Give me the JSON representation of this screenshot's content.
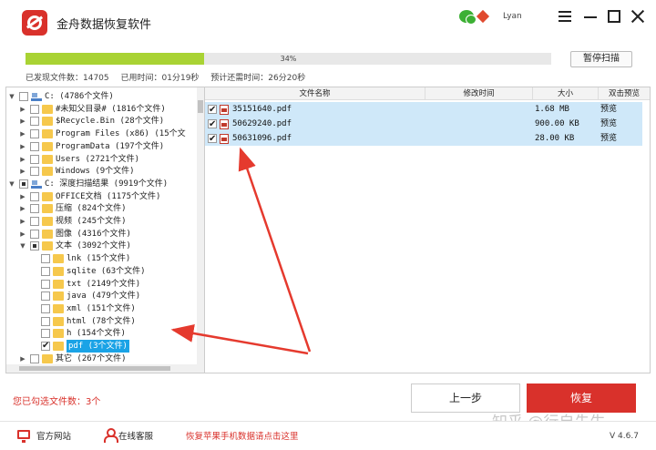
{
  "app": {
    "title": "金舟数据恢复软件",
    "user": "Lyan"
  },
  "scan": {
    "progress_label": "34%",
    "progress_fraction": 0.34,
    "pause_label": "暂停扫描",
    "found": "已发现文件数：14705",
    "elapsed": "已用时间：01分19秒",
    "remaining": "预计还需时间：26分20秒"
  },
  "tree": [
    {
      "label": "C:   (4786个文件)",
      "level": 0,
      "expander": "▼",
      "icon": "drive-icon",
      "check": ""
    },
    {
      "label": "#未知父目录#   (1816个文件)",
      "level": 1,
      "expander": "▶",
      "icon": "folder-icon",
      "check": ""
    },
    {
      "label": "$Recycle.Bin   (28个文件)",
      "level": 1,
      "expander": "▶",
      "icon": "folder-icon",
      "check": ""
    },
    {
      "label": "Program Files (x86)   (15个文",
      "level": 1,
      "expander": "▶",
      "icon": "folder-icon",
      "check": ""
    },
    {
      "label": "ProgramData   (197个文件)",
      "level": 1,
      "expander": "▶",
      "icon": "folder-icon",
      "check": ""
    },
    {
      "label": "Users   (2721个文件)",
      "level": 1,
      "expander": "▶",
      "icon": "folder-icon",
      "check": ""
    },
    {
      "label": "Windows   (9个文件)",
      "level": 1,
      "expander": "▶",
      "icon": "folder-icon",
      "check": ""
    },
    {
      "label": "C: 深度扫描结果   (9919个文件)",
      "level": 0,
      "expander": "▼",
      "icon": "drive-icon",
      "check": "partial"
    },
    {
      "label": "OFFICE文档   (1175个文件)",
      "level": 1,
      "expander": "▶",
      "icon": "folder-icon",
      "check": ""
    },
    {
      "label": "压缩   (824个文件)",
      "level": 1,
      "expander": "▶",
      "icon": "folder-icon",
      "check": ""
    },
    {
      "label": "视频   (245个文件)",
      "level": 1,
      "expander": "▶",
      "icon": "folder-icon",
      "check": ""
    },
    {
      "label": "图像   (4316个文件)",
      "level": 1,
      "expander": "▶",
      "icon": "folder-icon",
      "check": ""
    },
    {
      "label": "文本   (3092个文件)",
      "level": 1,
      "expander": "▼",
      "icon": "folder-icon",
      "check": "partial"
    },
    {
      "label": "lnk   (15个文件)",
      "level": 2,
      "expander": "",
      "icon": "folder-icon",
      "check": ""
    },
    {
      "label": "sqlite   (63个文件)",
      "level": 2,
      "expander": "",
      "icon": "folder-icon",
      "check": ""
    },
    {
      "label": "txt   (2149个文件)",
      "level": 2,
      "expander": "",
      "icon": "folder-icon",
      "check": ""
    },
    {
      "label": "java   (479个文件)",
      "level": 2,
      "expander": "",
      "icon": "folder-icon",
      "check": ""
    },
    {
      "label": "xml   (151个文件)",
      "level": 2,
      "expander": "",
      "icon": "folder-icon",
      "check": ""
    },
    {
      "label": "html   (78个文件)",
      "level": 2,
      "expander": "",
      "icon": "folder-icon",
      "check": ""
    },
    {
      "label": "h   (154个文件)",
      "level": 2,
      "expander": "",
      "icon": "folder-icon",
      "check": ""
    },
    {
      "label": "pdf   (3个文件)",
      "level": 2,
      "expander": "",
      "icon": "folder-icon",
      "check": "checked",
      "selected": true
    },
    {
      "label": "其它   (267个文件)",
      "level": 1,
      "expander": "▶",
      "icon": "folder-icon",
      "check": ""
    }
  ],
  "files": {
    "columns": [
      "文件名称",
      "修改时间",
      "大小",
      "双击预览"
    ],
    "rows": [
      {
        "name": "35151640.pdf",
        "modified": "",
        "size": "1.68 MB",
        "preview": "预览"
      },
      {
        "name": "50629240.pdf",
        "modified": "",
        "size": "900.00 KB",
        "preview": "预览"
      },
      {
        "name": "50631096.pdf",
        "modified": "",
        "size": "28.00 KB",
        "preview": "预览"
      }
    ]
  },
  "selection": {
    "count_label": "您已勾选文件数：3个"
  },
  "buttons": {
    "back": "上一步",
    "restore": "恢复"
  },
  "footer": {
    "website": "官方网站",
    "support": "在线客服",
    "apple": "恢复苹果手机数据请点击这里",
    "version": "V 4.6.7"
  },
  "watermark": "知乎 @行自先生",
  "colors": {
    "accent": "#d9312b",
    "progress": "#a9d334",
    "selection": "#1aa3e6",
    "row_highlight": "#cfe8f9"
  }
}
